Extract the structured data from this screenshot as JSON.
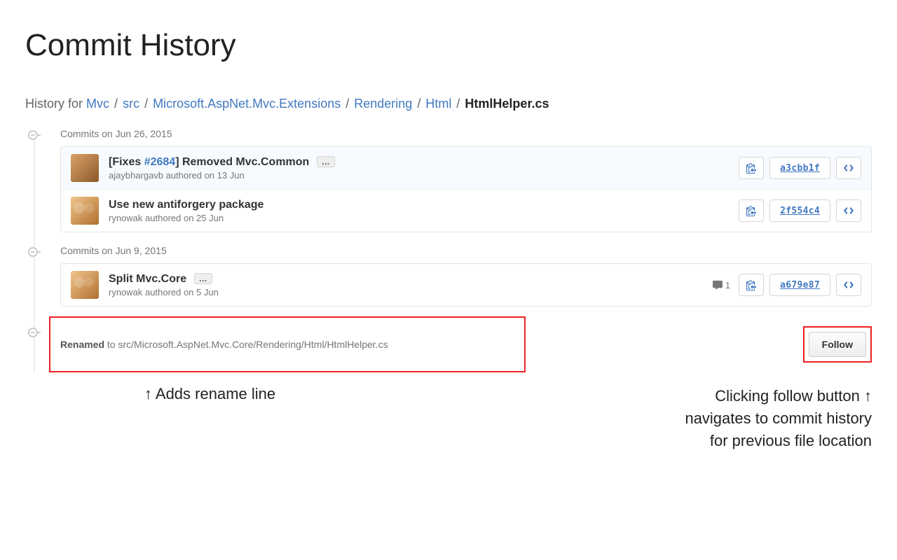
{
  "title": "Commit History",
  "breadcrumb": {
    "prefix": "History for",
    "parts": [
      "Mvc",
      "src",
      "Microsoft.AspNet.Mvc.Extensions",
      "Rendering",
      "Html"
    ],
    "current": "HtmlHelper.cs"
  },
  "groups": [
    {
      "header": "Commits on Jun 26, 2015",
      "commits": [
        {
          "title_prefix": "[Fixes ",
          "issue": "#2684",
          "title_suffix": "] Removed Mvc.Common",
          "has_ellipsis": true,
          "author": "ajaybhargavb",
          "authored": " authored on 13 Jun",
          "sha": "a3cbb1f",
          "avatar_class": "a1",
          "highlight": true,
          "comments": null
        },
        {
          "title_prefix": "",
          "issue": "",
          "title_suffix": "Use new antiforgery package",
          "has_ellipsis": false,
          "author": "rynowak",
          "authored": " authored on 25 Jun",
          "sha": "2f554c4",
          "avatar_class": "a2",
          "highlight": false,
          "comments": null
        }
      ]
    },
    {
      "header": "Commits on Jun 9, 2015",
      "commits": [
        {
          "title_prefix": "",
          "issue": "",
          "title_suffix": "Split Mvc.Core",
          "has_ellipsis": true,
          "author": "rynowak",
          "authored": " authored on 5 Jun",
          "sha": "a679e87",
          "avatar_class": "a2",
          "highlight": false,
          "comments": "1"
        }
      ]
    }
  ],
  "rename": {
    "label": "Renamed",
    "to_text": " to src/Microsoft.AspNet.Mvc.Core/Rendering/Html/HtmlHelper.cs",
    "follow_label": "Follow"
  },
  "annotations": {
    "left": "↑ Adds rename line",
    "right_l1": "Clicking follow button ↑",
    "right_l2": "navigates to commit history",
    "right_l3": "for previous file location"
  },
  "icons": {
    "clipboard": "clipboard-icon",
    "code": "code-icon",
    "comment": "comment-icon"
  }
}
